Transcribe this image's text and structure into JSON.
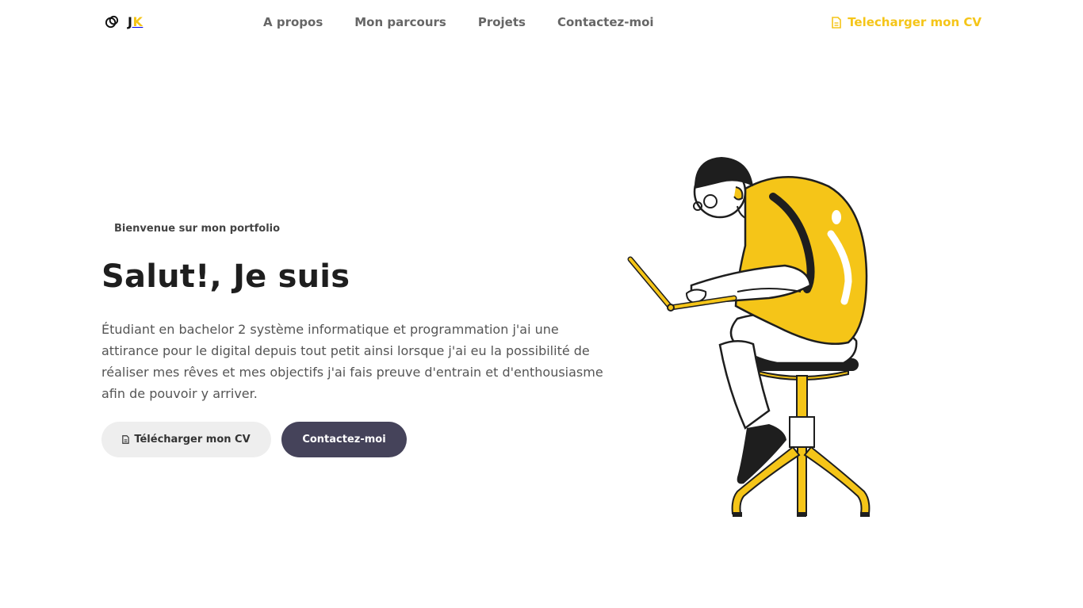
{
  "nav": {
    "logo_j": "J",
    "logo_k": "K",
    "links": [
      "A propos",
      "Mon parcours",
      "Projets",
      "Contactez-moi"
    ],
    "cv_label": "Telecharger mon CV"
  },
  "hero": {
    "welcome": "Bienvenue sur mon portfolio",
    "title": "Salut!, Je suis",
    "description": "Étudiant en bachelor 2 système informatique et programmation j'ai une attirance pour le digital depuis tout petit ainsi lorsque j'ai eu la possibilité de réaliser mes rêves et mes objectifs j'ai fais preuve d'entrain et d'enthousiasme afin de pouvoir y arriver.",
    "btn_cv": "Télécharger mon CV",
    "btn_contact": "Contactez-moi"
  },
  "colors": {
    "accent": "#f5c518",
    "dark_button": "#45435a",
    "light_button": "#eeeeee"
  },
  "icons": {
    "logo": "logo-icon",
    "document": "document-icon"
  }
}
